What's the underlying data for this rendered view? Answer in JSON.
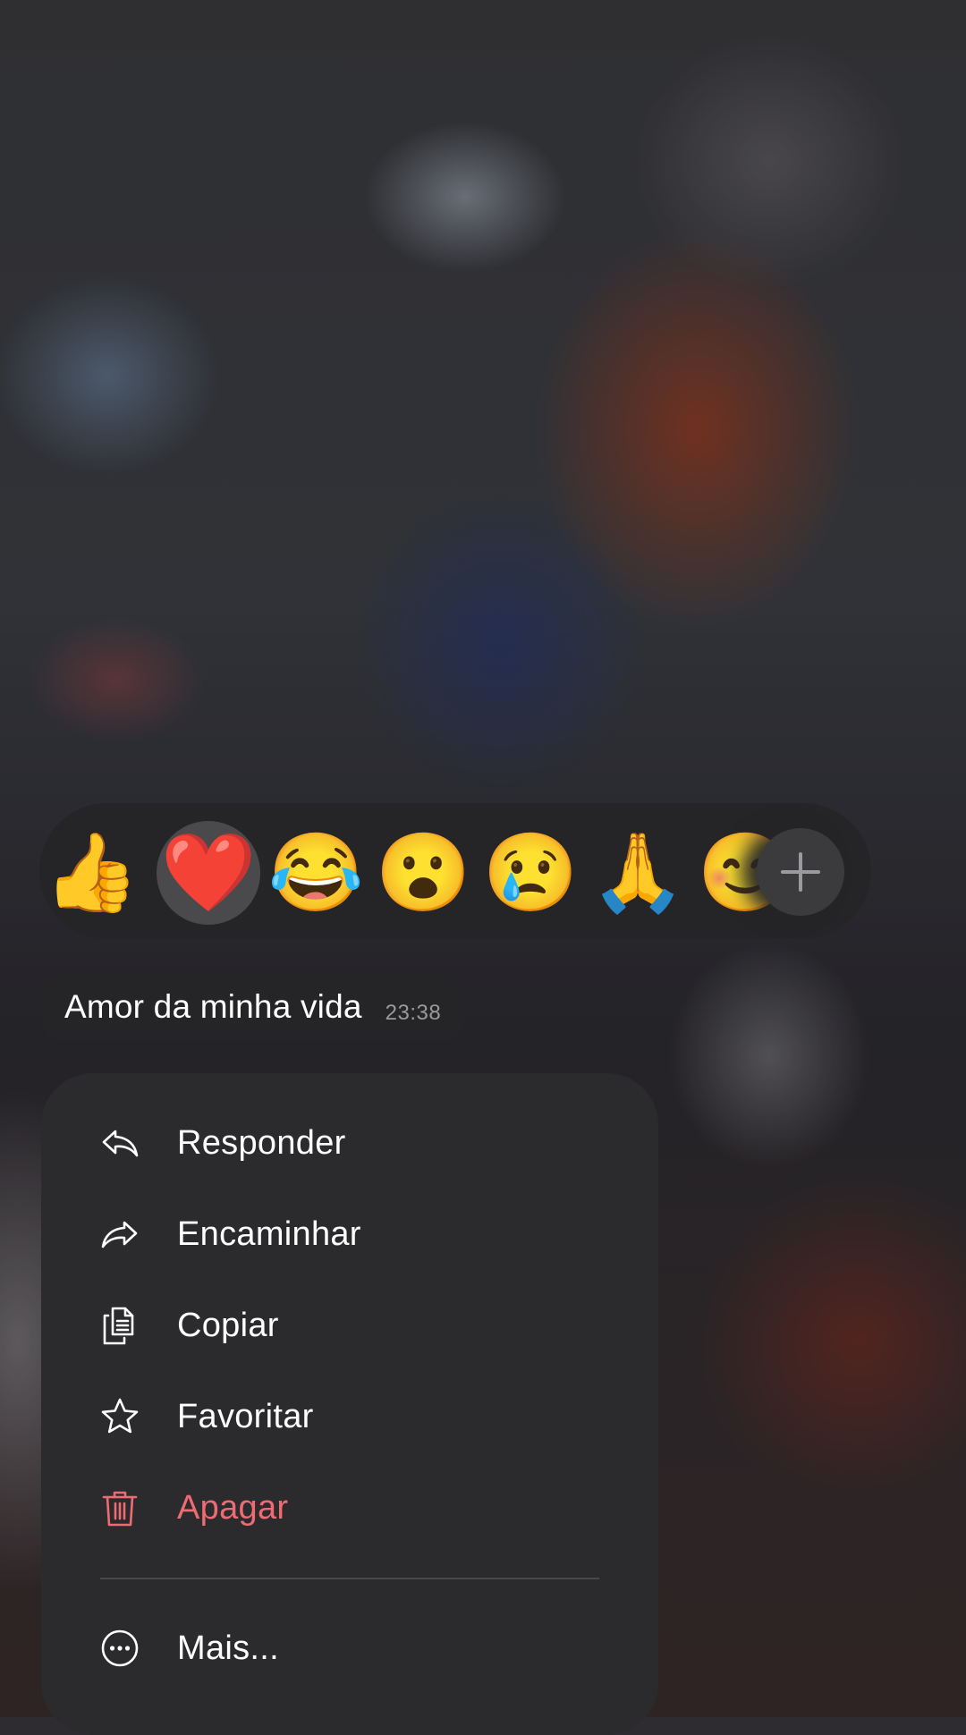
{
  "reactions": {
    "items": [
      {
        "emoji": "👍",
        "name": "thumbs-up"
      },
      {
        "emoji": "❤️",
        "name": "red-heart",
        "selected": true
      },
      {
        "emoji": "😂",
        "name": "tears-of-joy"
      },
      {
        "emoji": "😮",
        "name": "surprised"
      },
      {
        "emoji": "😢",
        "name": "crying"
      },
      {
        "emoji": "🙏",
        "name": "folded-hands"
      },
      {
        "emoji": "😊",
        "name": "smiling"
      }
    ],
    "more_icon": "plus-icon"
  },
  "message": {
    "text": "Amor da minha vida",
    "time": "23:38"
  },
  "menu": {
    "items": [
      {
        "label": "Responder",
        "icon": "reply-icon"
      },
      {
        "label": "Encaminhar",
        "icon": "forward-icon"
      },
      {
        "label": "Copiar",
        "icon": "copy-icon"
      },
      {
        "label": "Favoritar",
        "icon": "star-icon"
      },
      {
        "label": "Apagar",
        "icon": "trash-icon",
        "danger": true
      },
      {
        "label": "Mais...",
        "icon": "more-icon"
      }
    ]
  },
  "colors": {
    "danger": "#ee6b73",
    "surface": "#2b2b2e",
    "bubble": "#252527"
  }
}
